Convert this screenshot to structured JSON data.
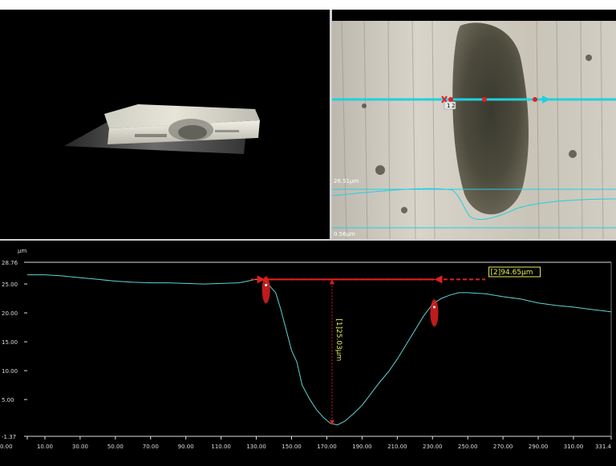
{
  "view3d": {
    "label": "3d-surface-view"
  },
  "optical": {
    "scale_top": "26.51µm",
    "scale_bottom": "0.56µm",
    "marker_labels": [
      "1",
      "2"
    ]
  },
  "profile": {
    "unit": "µm",
    "y_ticks": [
      "28.76",
      "25.00",
      "20.00",
      "15.00",
      "10.00",
      "5.00",
      "-1.37"
    ],
    "x_ticks": [
      "0.00",
      "10.00",
      "30.00",
      "50.00",
      "70.00",
      "90.00",
      "110.00",
      "130.00",
      "150.00",
      "170.00",
      "190.00",
      "210.00",
      "230.00",
      "250.00",
      "270.00",
      "290.00",
      "310.00",
      "331.4"
    ],
    "measurements": {
      "depth_label": "[1]25.03µm",
      "width_label": "[2]94.65µm"
    },
    "colors": {
      "curve": "#5fd3d3",
      "marker": "#e02020",
      "label": "#e8e85a"
    }
  },
  "chart_data": {
    "type": "line",
    "xlabel": "",
    "ylabel": "µm",
    "xlim": [
      0,
      331.4
    ],
    "ylim": [
      -1.37,
      28.76
    ],
    "x": [
      0,
      10,
      20,
      30,
      40,
      50,
      60,
      70,
      80,
      90,
      100,
      110,
      120,
      125,
      130,
      135,
      138,
      141,
      144,
      147,
      150,
      153,
      156,
      160,
      164,
      168,
      172,
      176,
      180,
      185,
      190,
      195,
      200,
      205,
      210,
      215,
      220,
      225,
      230,
      235,
      240,
      245,
      250,
      255,
      260,
      270,
      280,
      290,
      300,
      310,
      320,
      331.4
    ],
    "y": [
      26.6,
      26.6,
      26.4,
      26.1,
      25.8,
      25.5,
      25.3,
      25.2,
      25.2,
      25.1,
      25.0,
      25.1,
      25.2,
      25.5,
      25.8,
      25.6,
      24.5,
      23.5,
      20.5,
      17.0,
      13.5,
      11.5,
      7.5,
      5.2,
      3.3,
      1.9,
      0.9,
      0.6,
      1.2,
      2.5,
      4.0,
      6.0,
      8.0,
      9.8,
      12.0,
      14.5,
      17.0,
      19.5,
      21.5,
      22.5,
      23.1,
      23.5,
      23.5,
      23.4,
      23.3,
      22.8,
      22.4,
      21.7,
      21.3,
      21.0,
      20.6,
      20.2
    ]
  }
}
